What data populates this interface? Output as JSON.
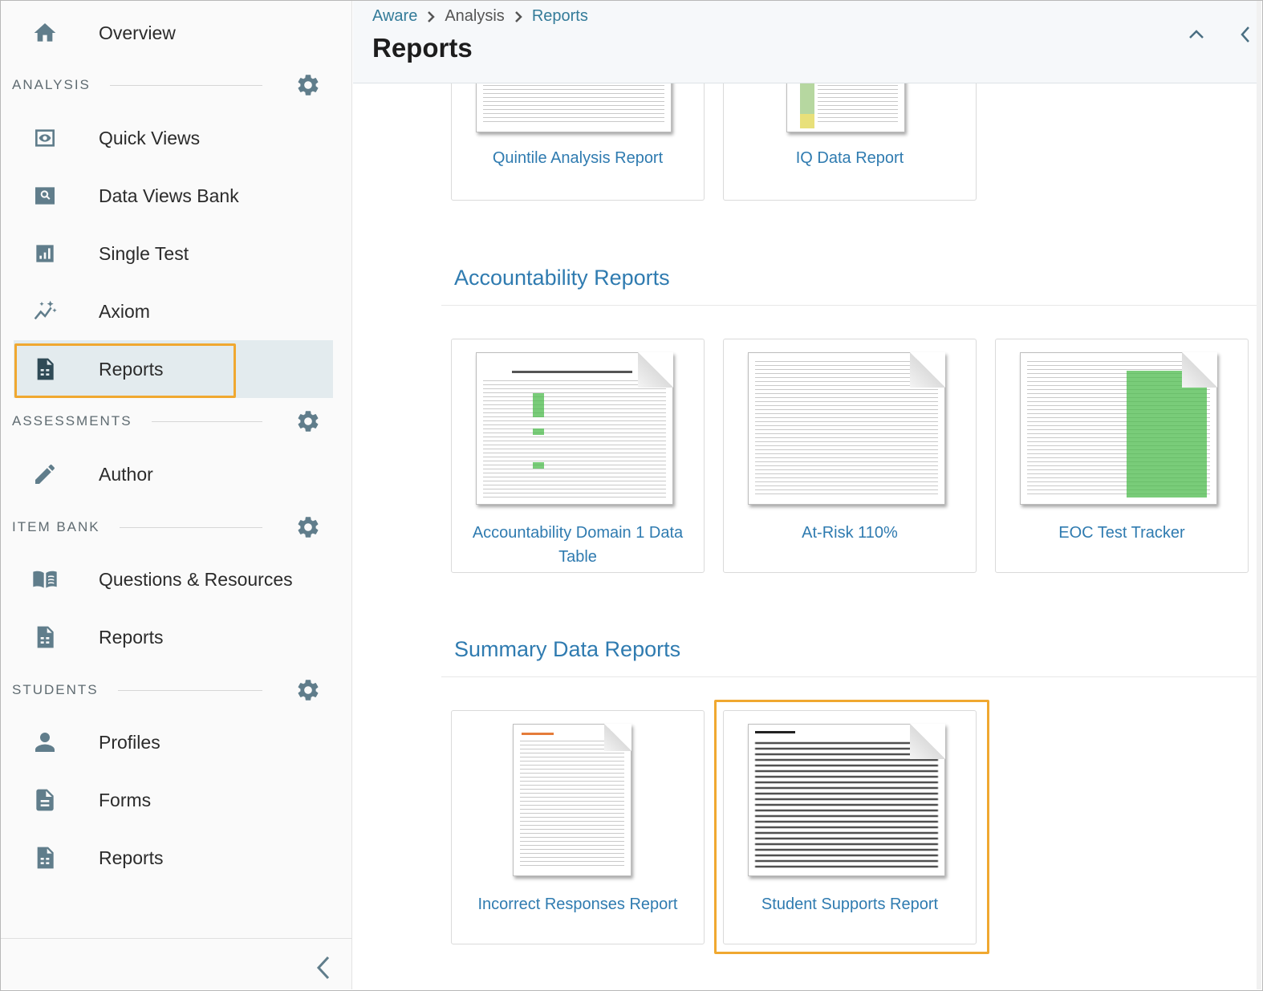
{
  "sidebar": {
    "top_item": {
      "label": "Overview",
      "icon": "home-icon"
    },
    "sections": [
      {
        "title": "ANALYSIS",
        "items": [
          {
            "label": "Quick Views",
            "icon": "eye-icon"
          },
          {
            "label": "Data Views Bank",
            "icon": "search-icon"
          },
          {
            "label": "Single Test",
            "icon": "bar-chart-icon"
          },
          {
            "label": "Axiom",
            "icon": "trend-icon"
          },
          {
            "label": "Reports",
            "icon": "report-icon",
            "active": true
          }
        ]
      },
      {
        "title": "ASSESSMENTS",
        "items": [
          {
            "label": "Author",
            "icon": "pencil-icon"
          }
        ]
      },
      {
        "title": "ITEM BANK",
        "items": [
          {
            "label": "Questions & Resources",
            "icon": "book-icon"
          },
          {
            "label": "Reports",
            "icon": "report-icon"
          }
        ]
      },
      {
        "title": "STUDENTS",
        "items": [
          {
            "label": "Profiles",
            "icon": "person-icon"
          },
          {
            "label": "Forms",
            "icon": "form-icon"
          },
          {
            "label": "Reports",
            "icon": "report-icon"
          }
        ]
      }
    ]
  },
  "header": {
    "breadcrumb": [
      "Aware",
      "Analysis",
      "Reports"
    ],
    "title": "Reports"
  },
  "main": {
    "partial_cards": [
      "Quintile Analysis Report",
      "IQ Data Report"
    ],
    "sections": [
      {
        "title": "Accountability Reports",
        "cards": [
          "Accountability Domain 1 Data Table",
          "At-Risk 110%",
          "EOC Test Tracker"
        ]
      },
      {
        "title": "Summary Data Reports",
        "cards": [
          "Incorrect Responses Report",
          "Student Supports Report"
        ]
      }
    ]
  },
  "colors": {
    "accent": "#2f7bb0",
    "highlight": "#f0a830",
    "icon": "#607d8b",
    "active_bg": "#e3ebee"
  }
}
